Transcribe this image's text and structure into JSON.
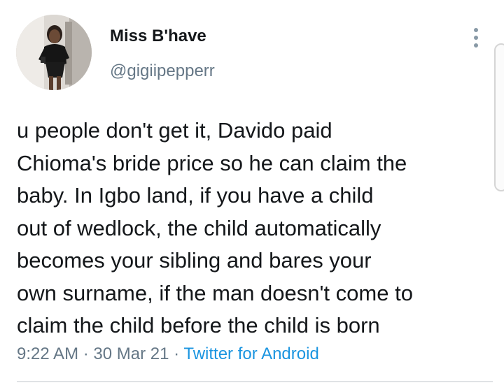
{
  "user": {
    "display_name": "Miss B'have",
    "handle": "@gigiipepperr"
  },
  "tweet": {
    "text": "u people don't get it, Davido paid\nChioma's bride price so he can claim the\nbaby. In Igbo land, if you have a child\nout of wedlock, the child automatically\nbecomes your sibling and bares your\nown surname, if the man doesn't come to\nclaim the child before the child is born"
  },
  "meta": {
    "time": "9:22 AM",
    "separator": "·",
    "date": "30 Mar 21",
    "source": "Twitter for Android"
  },
  "icons": {
    "more": "more-vertical-icon",
    "avatar": "avatar"
  },
  "colors": {
    "text": "#14171a",
    "secondary": "#657786",
    "link": "#1b95e0"
  }
}
